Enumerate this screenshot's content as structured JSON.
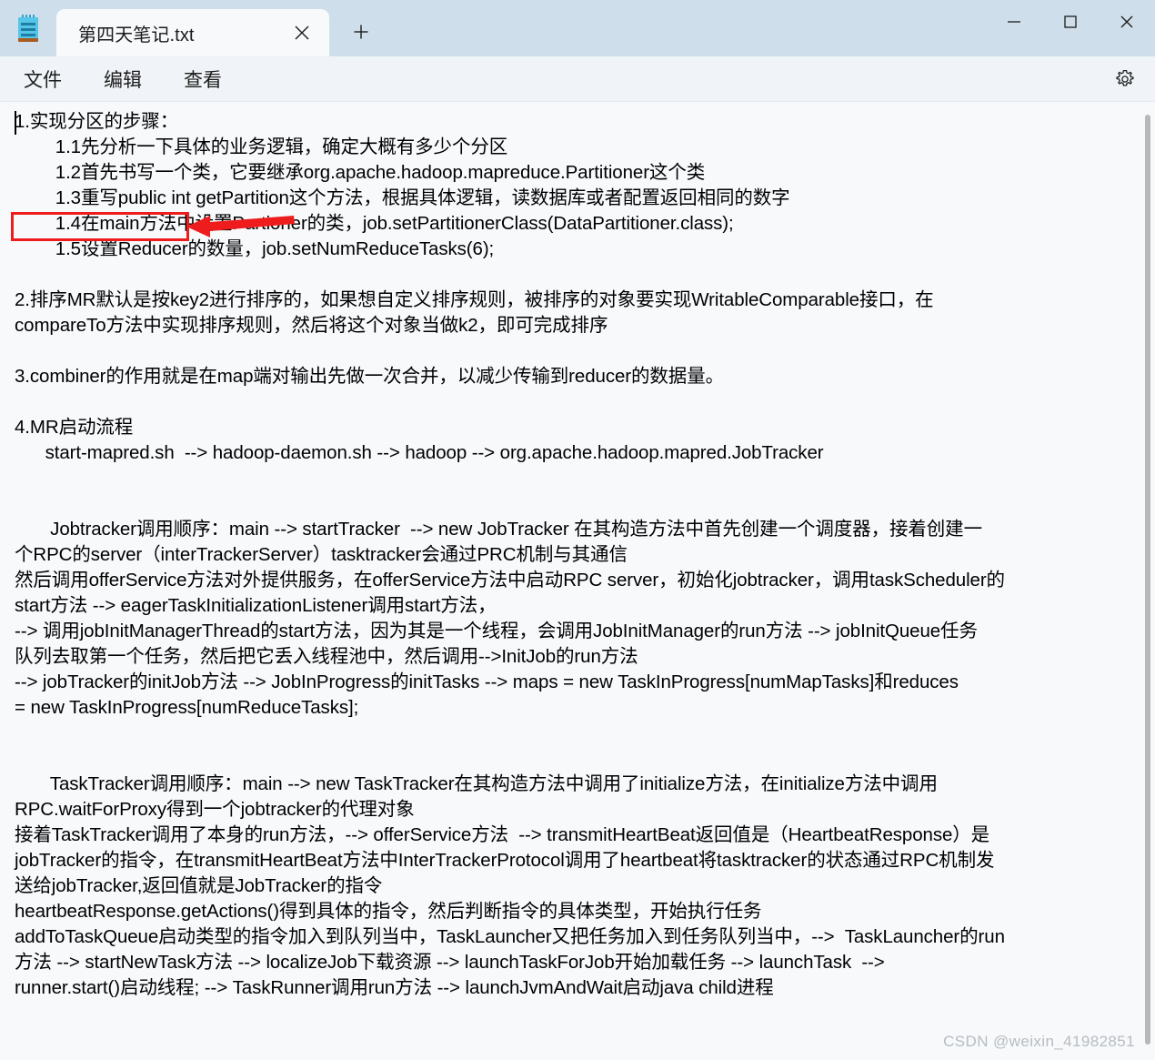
{
  "window": {
    "app_icon": "notepad-icon",
    "controls": {
      "minimize": "minimize-icon",
      "maximize": "maximize-icon",
      "close": "close-icon"
    }
  },
  "tabs": [
    {
      "title": "第四天笔记.txt",
      "active": true,
      "close_icon": "close-icon"
    }
  ],
  "new_tab": {
    "icon": "plus-icon",
    "label": "+"
  },
  "menubar": {
    "items": [
      {
        "label": "文件"
      },
      {
        "label": "编辑"
      },
      {
        "label": "查看"
      }
    ],
    "settings_icon": "gear-icon"
  },
  "document": {
    "lines": [
      "1.实现分区的步骤：",
      "        1.1先分析一下具体的业务逻辑，确定大概有多少个分区",
      "        1.2首先书写一个类，它要继承org.apache.hadoop.mapreduce.Partitioner这个类",
      "        1.3重写public int getPartition这个方法，根据具体逻辑，读数据库或者配置返回相同的数字",
      "        1.4在main方法中设置Partioner的类，job.setPartitionerClass(DataPartitioner.class);",
      "        1.5设置Reducer的数量，job.setNumReduceTasks(6);",
      "",
      "2.排序MR默认是按key2进行排序的，如果想自定义排序规则，被排序的对象要实现WritableComparable接口，在",
      "compareTo方法中实现排序规则，然后将这个对象当做k2，即可完成排序",
      "",
      "3.combiner的作用就是在map端对输出先做一次合并，以减少传输到reducer的数据量。",
      "",
      "4.MR启动流程",
      "      start-mapred.sh  --> hadoop-daemon.sh --> hadoop --> org.apache.hadoop.mapred.JobTracker",
      "",
      "",
      "       Jobtracker调用顺序：main --> startTracker  --> new JobTracker 在其构造方法中首先创建一个调度器，接着创建一",
      "个RPC的server（interTrackerServer）tasktracker会通过PRC机制与其通信",
      "然后调用offerService方法对外提供服务，在offerService方法中启动RPC server，初始化jobtracker，调用taskScheduler的",
      "start方法 --> eagerTaskInitializationListener调用start方法，",
      "--> 调用jobInitManagerThread的start方法，因为其是一个线程，会调用JobInitManager的run方法 --> jobInitQueue任务",
      "队列去取第一个任务，然后把它丢入线程池中，然后调用-->InitJob的run方法",
      "--> jobTracker的initJob方法 --> JobInProgress的initTasks --> maps = new TaskInProgress[numMapTasks]和reduces",
      "= new TaskInProgress[numReduceTasks];",
      "",
      "",
      "       TaskTracker调用顺序：main --> new TaskTracker在其构造方法中调用了initialize方法，在initialize方法中调用",
      "RPC.waitForProxy得到一个jobtracker的代理对象",
      "接着TaskTracker调用了本身的run方法，--> offerService方法  --> transmitHeartBeat返回值是（HeartbeatResponse）是",
      "jobTracker的指令，在transmitHeartBeat方法中InterTrackerProtocol调用了heartbeat将tasktracker的状态通过RPC机制发",
      "送给jobTracker,返回值就是JobTracker的指令",
      "heartbeatResponse.getActions()得到具体的指令，然后判断指令的具体类型，开始执行任务",
      "addToTaskQueue启动类型的指令加入到队列当中，TaskLauncher又把任务加入到任务队列当中，-->  TaskLauncher的run",
      "方法 --> startNewTask方法 --> localizeJob下载资源 --> launchTaskForJob开始加载任务 --> launchTask  -->",
      "runner.start()启动线程; --> TaskRunner调用run方法 --> launchJvmAndWait启动java child进程"
    ]
  },
  "annotation": {
    "box_color": "#ee1c1c",
    "arrow_color": "#ee1c1c",
    "target_text": "1.实现分区的步骤："
  },
  "watermark": {
    "text": "CSDN @weixin_41982851"
  },
  "colors": {
    "titlebar_bg": "#cedfeb",
    "menubar_bg": "#f0f4f8",
    "editor_bg": "#f7f9fb",
    "text": "#000000",
    "accent_red": "#ee1c1c"
  }
}
